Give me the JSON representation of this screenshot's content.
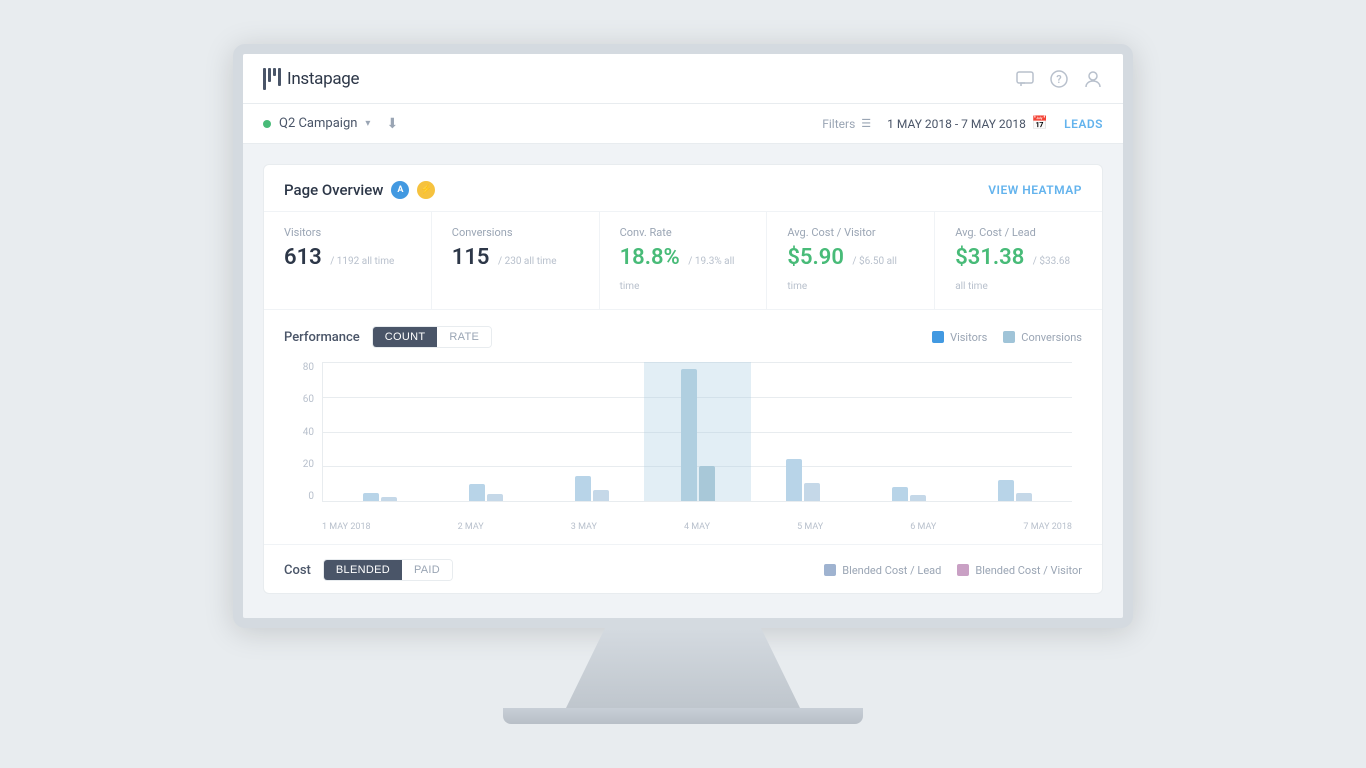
{
  "app": {
    "logo_text": "Instapage"
  },
  "header": {
    "icons": [
      "chat",
      "help",
      "user"
    ]
  },
  "sub_header": {
    "campaign_name": "Q2 Campaign",
    "status": "active",
    "filters_label": "Filters",
    "date_range": "1 MAY 2018 - 7 MAY 2018",
    "leads_label": "LEADS"
  },
  "page_overview": {
    "title": "Page Overview",
    "view_heatmap": "VIEW HEATMAP",
    "stats": [
      {
        "label": "Visitors",
        "value": "613",
        "sub": "/ 1192 all time"
      },
      {
        "label": "Conversions",
        "value": "115",
        "sub": "/ 230 all time"
      },
      {
        "label": "Conv. Rate",
        "value": "18.8%",
        "sub": "/ 19.3% all time",
        "green": true
      },
      {
        "label": "Avg. Cost / Visitor",
        "value": "$5.90",
        "sub": "/ $6.50 all time",
        "green": true
      },
      {
        "label": "Avg. Cost / Lead",
        "value": "$31.38",
        "sub": "/ $33.68 all time",
        "green": true
      }
    ]
  },
  "performance": {
    "title": "Performance",
    "tabs": [
      "COUNT",
      "RATE"
    ],
    "active_tab": "COUNT",
    "legend": [
      {
        "label": "Visitors",
        "color": "#b8d4e8"
      },
      {
        "label": "Conversions",
        "color": "#a0c4d8"
      }
    ],
    "y_labels": [
      "80",
      "60",
      "40",
      "20",
      "0"
    ],
    "x_labels": [
      "1 MAY 2018",
      "2 MAY",
      "3 MAY",
      "4 MAY",
      "5 MAY",
      "6 MAY",
      "7 MAY 2018"
    ],
    "bars": [
      {
        "visitors": 5,
        "conversions": 2
      },
      {
        "visitors": 10,
        "conversions": 4
      },
      {
        "visitors": 15,
        "conversions": 6
      },
      {
        "visitors": 80,
        "conversions": 20
      },
      {
        "visitors": 25,
        "conversions": 10
      },
      {
        "visitors": 8,
        "conversions": 3
      },
      {
        "visitors": 12,
        "conversions": 5
      }
    ]
  },
  "cost": {
    "title": "Cost",
    "tabs": [
      "BLENDED",
      "PAID"
    ],
    "active_tab": "BLENDED",
    "legend": [
      {
        "label": "Blended Cost / Lead",
        "color": "#9fb3d0"
      },
      {
        "label": "Blended Cost / Visitor",
        "color": "#c9a0c4"
      }
    ]
  }
}
